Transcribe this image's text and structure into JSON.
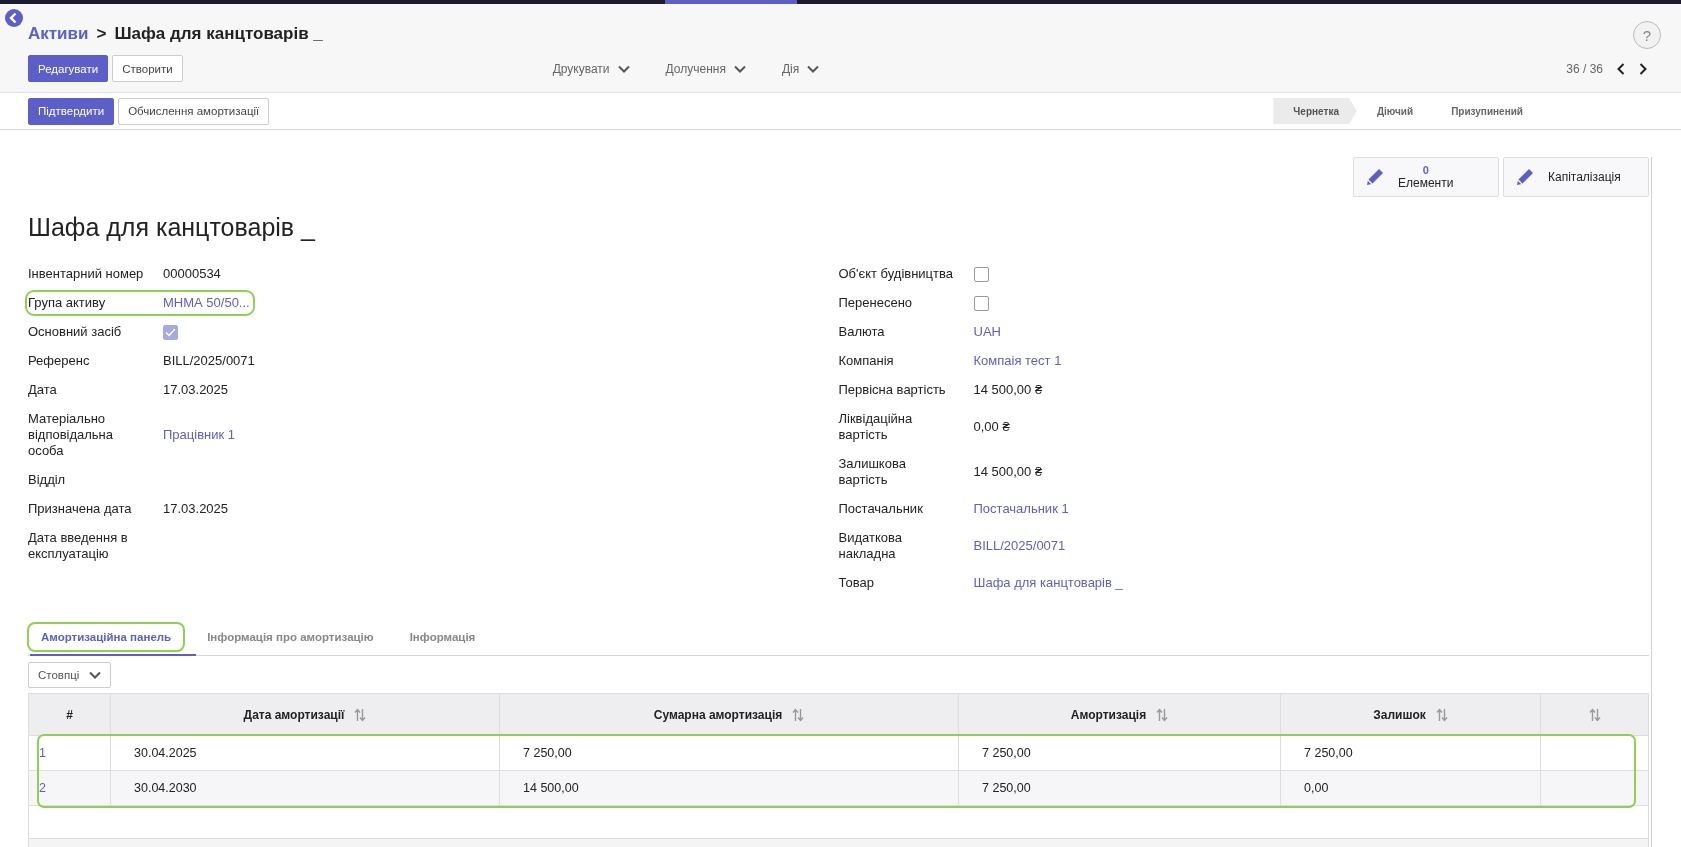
{
  "breadcrumb": {
    "parent": "Активи",
    "separator": ">",
    "current": "Шафа для канцтоварів _"
  },
  "help": "?",
  "actions": [
    {
      "label": "Редагувати",
      "kind": "primary"
    },
    {
      "label": "Створити",
      "kind": "secondary"
    }
  ],
  "menus": [
    "Друкувати",
    "Долучення",
    "Дія"
  ],
  "pager": {
    "text": "36 / 36"
  },
  "workflow": [
    {
      "label": "Підтвердити",
      "kind": "primary"
    },
    {
      "label": "Обчислення амортизації",
      "kind": "secondary"
    }
  ],
  "stages": [
    {
      "label": "Чернетка",
      "selected": true
    },
    {
      "label": "Діючий",
      "selected": false
    },
    {
      "label": "Призупинений",
      "selected": false
    }
  ],
  "smart_buttons": [
    {
      "count": "0",
      "label": "Елементи"
    },
    {
      "label": "Капіталізація"
    }
  ],
  "title": "Шафа для канцтоварів _",
  "left_fields": [
    {
      "label": "Інвентарний номер",
      "kind": "text",
      "value": "00000534",
      "highlighted": false
    },
    {
      "label": "Група активу",
      "kind": "link",
      "value": "МНМА 50/50...",
      "highlighted": true
    },
    {
      "label": "Основний засіб",
      "kind": "checkbox",
      "checked": true,
      "highlighted": false
    },
    {
      "label": "Референс",
      "kind": "text",
      "value": "BILL/2025/0071",
      "highlighted": false
    },
    {
      "label": "Дата",
      "kind": "text",
      "value": "17.03.2025",
      "highlighted": false
    },
    {
      "label": "Матеріально відповідальна особа",
      "kind": "link",
      "value": "Працівник 1",
      "highlighted": false
    },
    {
      "label": "Відділ",
      "kind": "empty",
      "highlighted": false
    },
    {
      "label": "Призначена дата",
      "kind": "text",
      "value": "17.03.2025",
      "highlighted": false
    },
    {
      "label": "Дата введення в експлуатацію",
      "kind": "empty",
      "highlighted": false
    }
  ],
  "right_fields": [
    {
      "label": "Об'єкт будівництва",
      "kind": "checkbox",
      "checked": false,
      "highlighted": false
    },
    {
      "label": "Перенесено",
      "kind": "checkbox",
      "checked": false,
      "highlighted": false
    },
    {
      "label": "Валюта",
      "kind": "link",
      "value": "UAH",
      "highlighted": false
    },
    {
      "label": "Компанія",
      "kind": "link",
      "value": "Компаія тест 1",
      "highlighted": false
    },
    {
      "label": "Первісна вартість",
      "kind": "text",
      "value": "14 500,00 ₴",
      "highlighted": false
    },
    {
      "label": "Ліквідаційна вартість",
      "kind": "text",
      "value": "0,00 ₴",
      "highlighted": false
    },
    {
      "label": "Залишкова вартість",
      "kind": "text",
      "value": "14 500,00 ₴",
      "highlighted": false
    },
    {
      "label": "Постачальник",
      "kind": "link",
      "value": "Постачальник 1",
      "highlighted": false
    },
    {
      "label": "Видаткова накладна",
      "kind": "link",
      "value": "BILL/2025/0071",
      "highlighted": false
    },
    {
      "label": "Товар",
      "kind": "link",
      "value": "Шафа для канцтоварів _",
      "highlighted": false
    }
  ],
  "tabs": [
    {
      "label": "Амортизаційна панель",
      "selected": true,
      "highlighted": true
    },
    {
      "label": "Інформація про амортизацію",
      "selected": false,
      "highlighted": false
    },
    {
      "label": "Інформація",
      "selected": false,
      "highlighted": false
    }
  ],
  "columns_button": "Стовпці",
  "table": {
    "columns": [
      {
        "label": "#",
        "sortable": false
      },
      {
        "label": "Дата амортизації",
        "sortable": true
      },
      {
        "label": "Сумарна амортизація",
        "sortable": true
      },
      {
        "label": "Амортизація",
        "sortable": true
      },
      {
        "label": "Залишок",
        "sortable": true
      },
      {
        "sortable": true
      }
    ],
    "rows_highlighted": true,
    "rows": [
      [
        "1",
        "30.04.2025",
        "7 250,00",
        "7 250,00",
        "7 250,00"
      ],
      [
        "2",
        "30.04.2030",
        "14 500,00",
        "7 250,00",
        "0,00"
      ]
    ]
  }
}
